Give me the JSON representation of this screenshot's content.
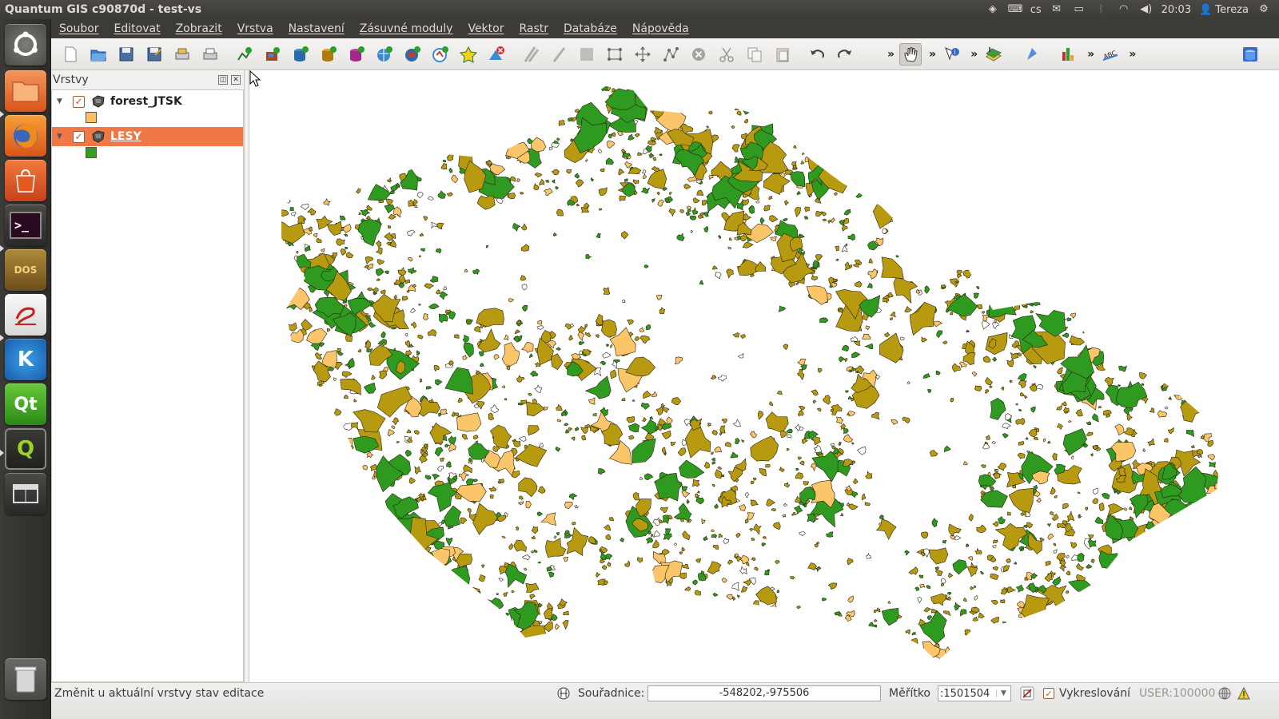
{
  "window": {
    "title": "Quantum GIS c90870d - test-vs"
  },
  "tray": {
    "keyboard_layout": "cs",
    "clock": "20:03",
    "user": "Tereza"
  },
  "launcher": {
    "items": [
      {
        "name": "dash-home",
        "label": ""
      },
      {
        "name": "files-app",
        "label": ""
      },
      {
        "name": "firefox-app",
        "label": ""
      },
      {
        "name": "software-center-app",
        "label": ""
      },
      {
        "name": "terminal-app",
        "label": ">_"
      },
      {
        "name": "dosbox-app",
        "label": "DOS"
      },
      {
        "name": "document-viewer-app",
        "label": ""
      },
      {
        "name": "kile-app",
        "label": "K"
      },
      {
        "name": "qt-creator-app",
        "label": "Qt"
      },
      {
        "name": "qgis-app",
        "label": "Q"
      },
      {
        "name": "workspace-switcher",
        "label": ""
      },
      {
        "name": "trash",
        "label": ""
      }
    ]
  },
  "menubar": {
    "items": [
      "Soubor",
      "Editovat",
      "Zobrazit",
      "Vrstva",
      "Nastavení",
      "Zásuvné moduly",
      "Vektor",
      "Rastr",
      "Databáze",
      "Nápověda"
    ]
  },
  "toolbar": {
    "more_symbol": "»",
    "buttons": [
      "new-project",
      "open-project",
      "save-project",
      "save-as",
      "print-composer",
      "print",
      "add-vector-layer",
      "add-raster-layer",
      "add-postgis-layer",
      "add-spatialite-layer",
      "add-mssql-layer",
      "add-wms-layer",
      "add-wcs-layer",
      "add-wfs-layer",
      "new-shapefile",
      "remove-layer",
      "current-edits",
      "toggle-editing",
      "save-edits",
      "add-feature",
      "move-feature",
      "node-tool",
      "delete-selected",
      "cut-features",
      "copy-features",
      "paste-features",
      "undo",
      "redo",
      "pan-map",
      "identify",
      "select-features",
      "measure",
      "histogram",
      "label"
    ]
  },
  "layers_panel": {
    "title": "Vrstvy",
    "layers": [
      {
        "name": "forest_JTSK",
        "checked": true,
        "selected": false,
        "swatch_color": "#fdc05f"
      },
      {
        "name": "LESY",
        "checked": true,
        "selected": true,
        "swatch_color": "#3a9a22"
      }
    ]
  },
  "map": {
    "colors": {
      "forest_jtsk": "#fbc56a",
      "lesy": "#2f9a20",
      "overlap": "#b89a10",
      "outline": "#2a2210"
    }
  },
  "statusbar": {
    "message": "Změnit u aktuální vrstvy stav editace",
    "coord_label": "Souřadnice:",
    "coord_value": "-548202,-975506",
    "scale_label": "Měřítko",
    "scale_value": ":1501504",
    "render_label": "Vykreslování",
    "render_checked": true,
    "user_crs": "USER:100000"
  }
}
